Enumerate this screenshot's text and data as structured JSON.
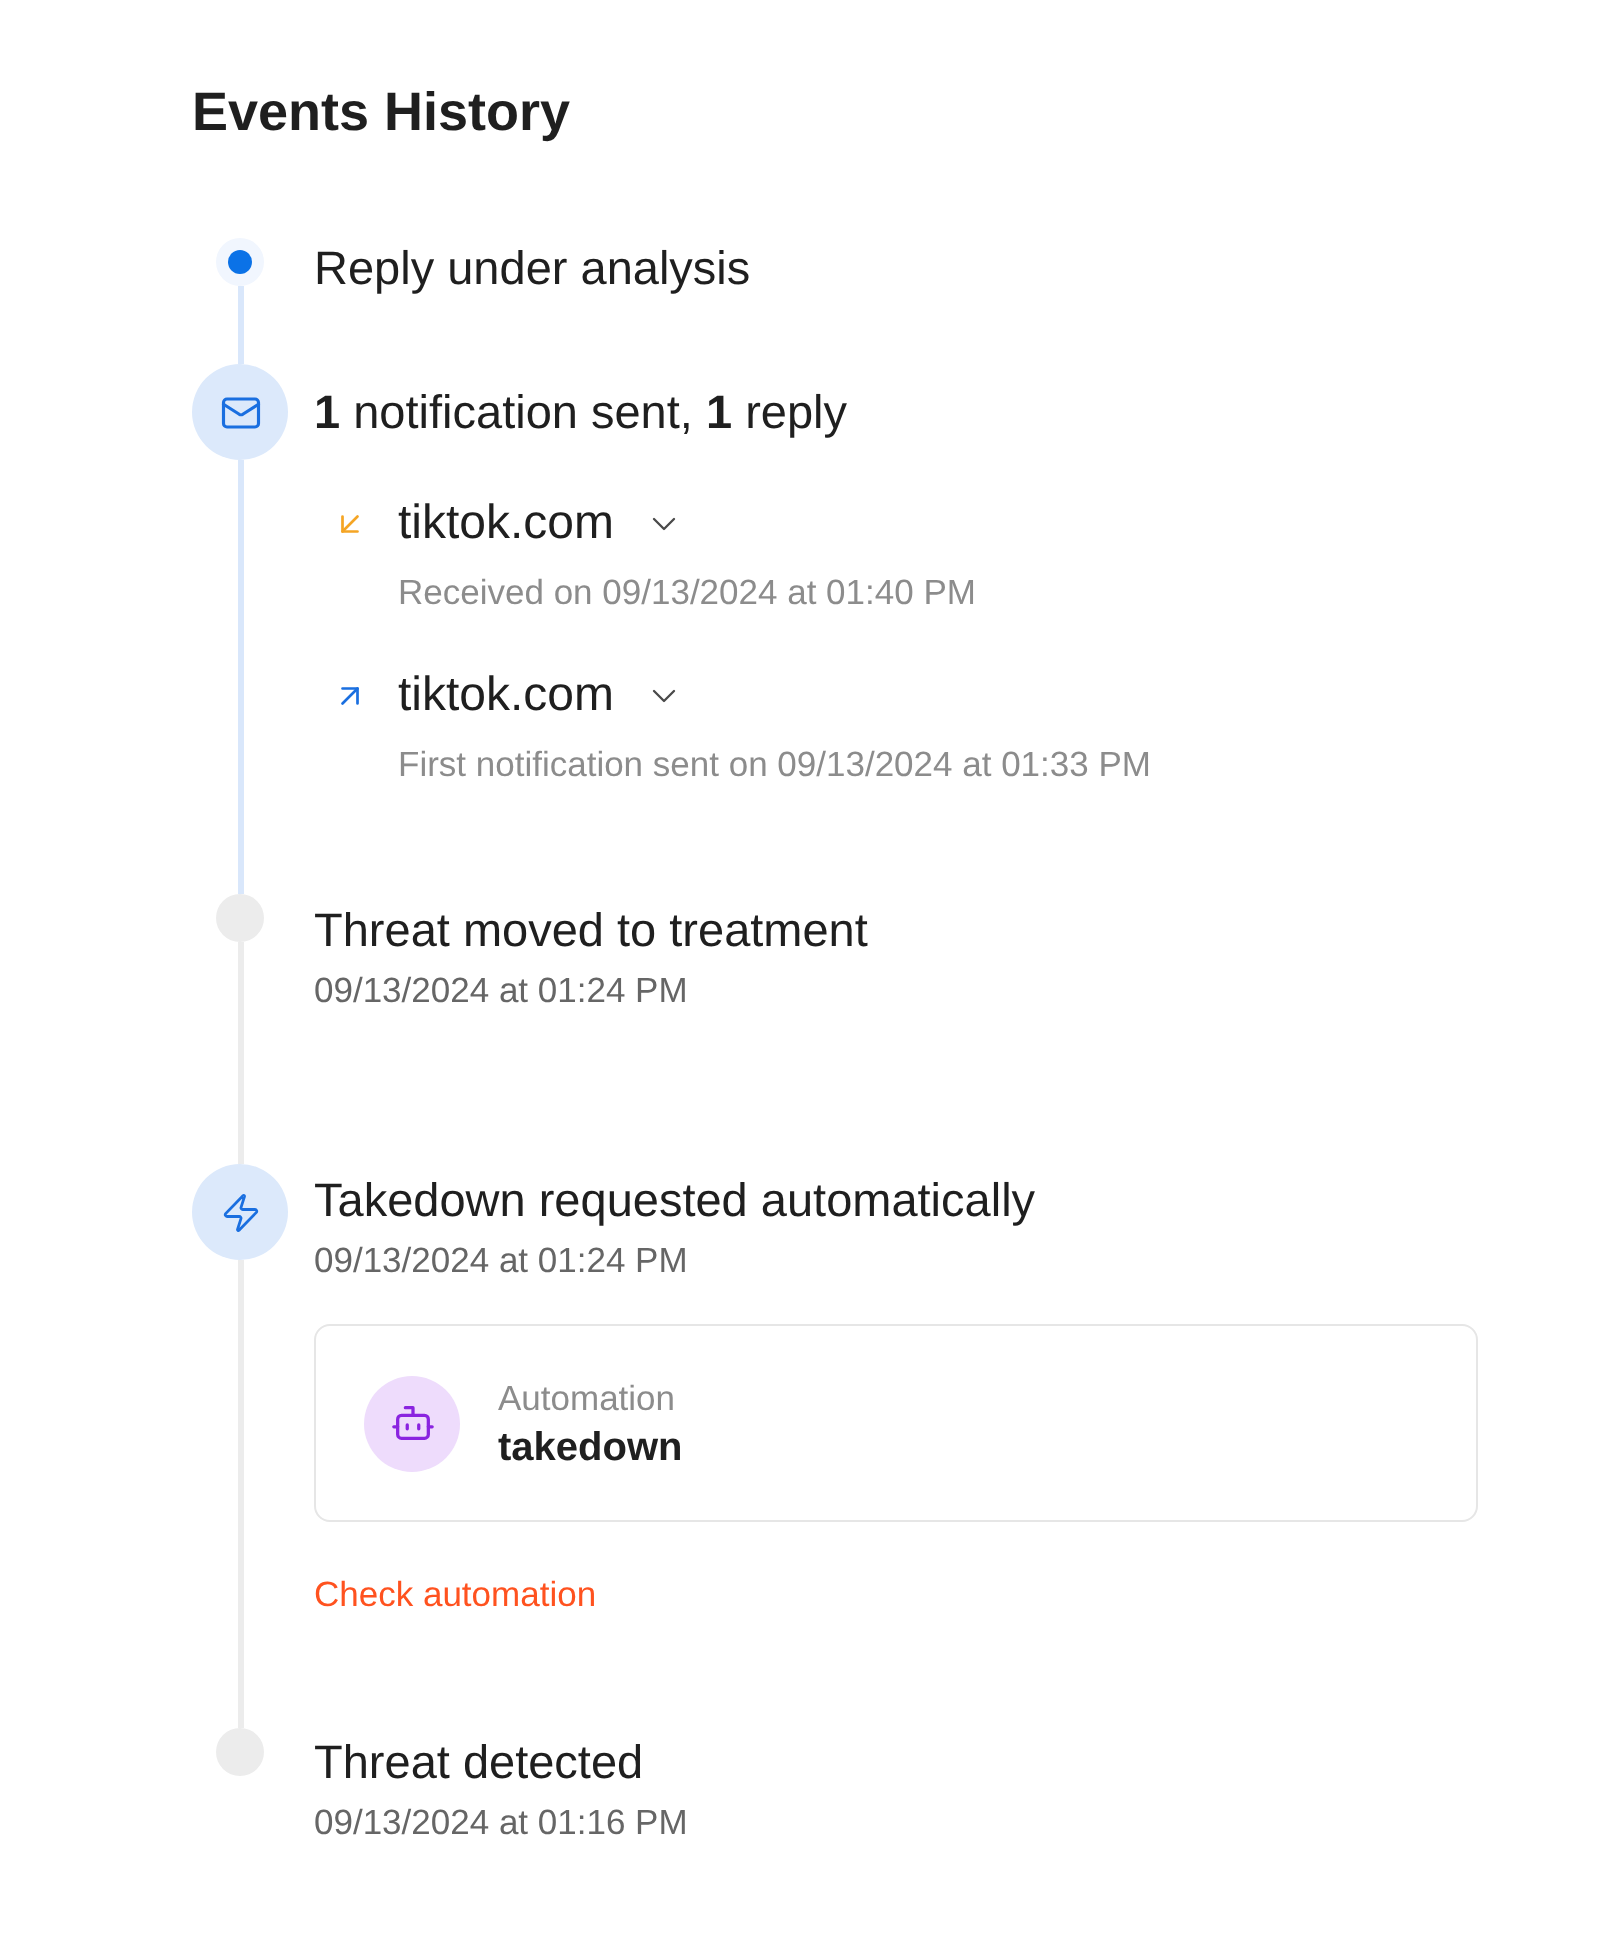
{
  "title": "Events History",
  "events": [
    {
      "kind": "pulse",
      "active": true,
      "title": "Reply under analysis"
    },
    {
      "kind": "mail",
      "active": true,
      "title": "**1** notification sent, **1** reply",
      "messages": [
        {
          "kind": "received",
          "domain": "tiktok.com",
          "expanded": false,
          "detail": "Received on 09/13/2024 at 01:40 PM"
        },
        {
          "kind": "sent",
          "domain": "tiktok.com",
          "expanded": false,
          "detail": "First notification sent on 09/13/2024 at 01:33 PM"
        }
      ]
    },
    {
      "kind": "plain",
      "active": false,
      "title": "Threat moved to treatment",
      "date": "09/13/2024 at 01:24 PM"
    },
    {
      "kind": "bolt",
      "active": false,
      "title": "Takedown requested automatically",
      "date": "09/13/2024 at 01:24 PM",
      "automation": {
        "label": "Automation",
        "name": "takedown"
      },
      "link": "Check automation"
    },
    {
      "kind": "plain",
      "active": false,
      "title": "Threat detected",
      "date": "09/13/2024 at 01:16 PM"
    }
  ]
}
